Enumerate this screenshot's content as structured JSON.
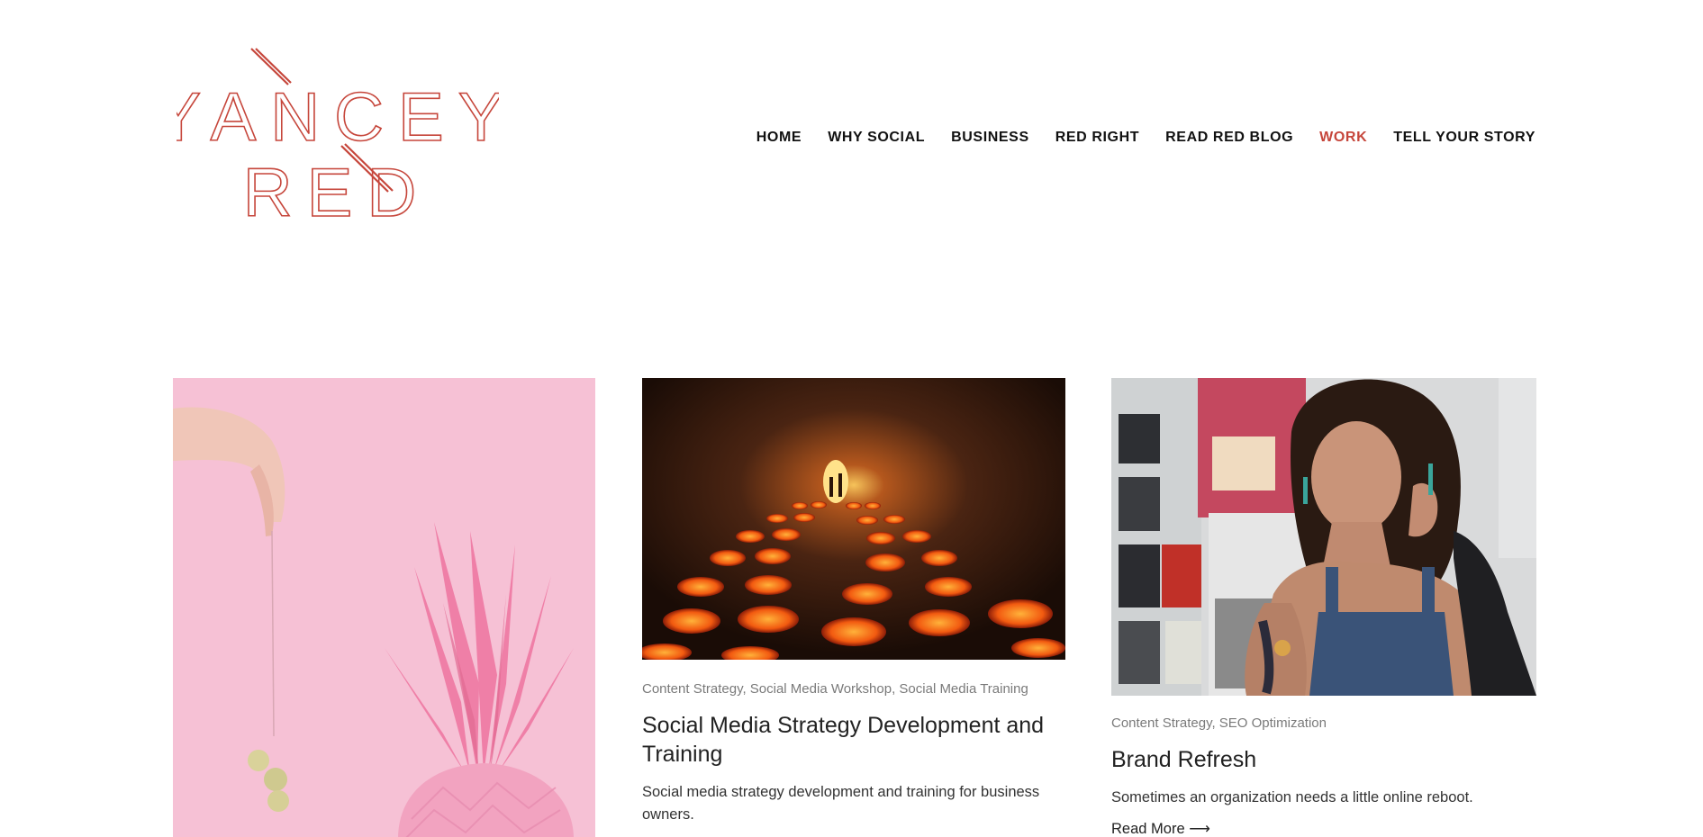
{
  "brand": {
    "logo_line1": "YANCEY",
    "logo_line2": "RED",
    "color": "#c6463b"
  },
  "nav": {
    "items": [
      {
        "label": "HOME",
        "active": false
      },
      {
        "label": "WHY SOCIAL",
        "active": false
      },
      {
        "label": "BUSINESS",
        "active": false
      },
      {
        "label": "RED RIGHT",
        "active": false
      },
      {
        "label": "READ RED BLOG",
        "active": false
      },
      {
        "label": "WORK",
        "active": true
      },
      {
        "label": "TELL YOUR STORY",
        "active": false
      }
    ]
  },
  "cards": [
    {
      "image": "pink-pineapple-and-grapes-photo"
    },
    {
      "image": "glowing-pots-in-tunnel-photo",
      "categories": "Content Strategy, Social Media Workshop, Social Media Training",
      "title": "Social Media Strategy Development and Training",
      "excerpt": "Social media strategy development and training for business owners."
    },
    {
      "image": "tattooed-woman-portrait-photo",
      "categories": "Content Strategy, SEO Optimization",
      "title": "Brand Refresh",
      "excerpt": "Sometimes an organization needs a little online reboot.",
      "read_more": "Read More ⟶"
    }
  ]
}
